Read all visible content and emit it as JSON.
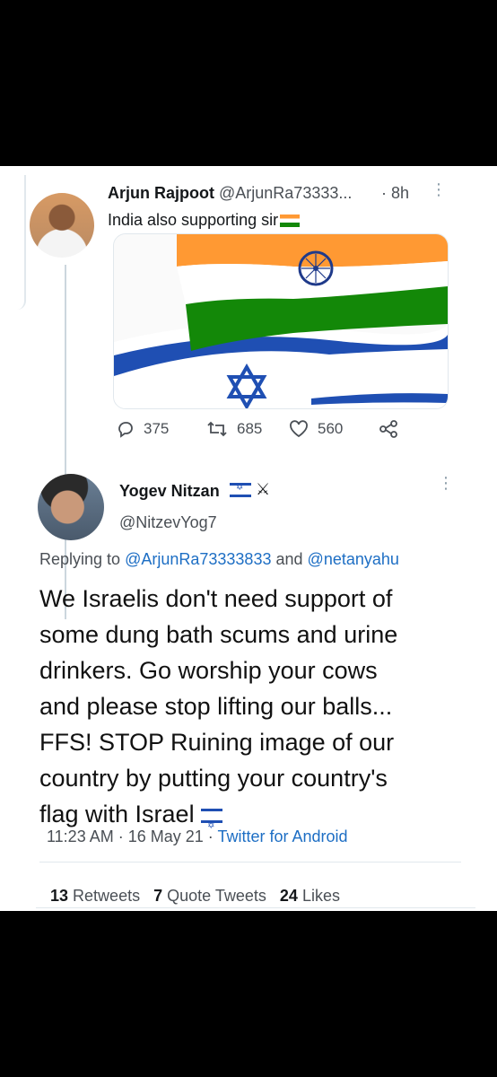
{
  "reply_tweet": {
    "author_name": "Arjun Rajpoot",
    "author_handle": "@ArjunRa73333...",
    "time": "· 8h",
    "menu": "⋮",
    "text": "India also supporting sir",
    "actions": {
      "replies": "375",
      "retweets": "685",
      "likes": "560"
    }
  },
  "main_tweet": {
    "author_name": "Yogev Nitzan",
    "author_handle": "@NitzevYog7",
    "menu": "⋮",
    "replying_prefix": "Replying to",
    "replying_user1": "@ArjunRa73333833",
    "replying_and": "and",
    "replying_user2": "@netanyahu",
    "body_lines": [
      "We Israelis don't need support of",
      "some dung bath scums and urine",
      "drinkers. Go worship your cows",
      "and please stop lifting our balls...",
      "FFS! STOP Ruining image of our",
      "country by putting your country's",
      "flag with Israel"
    ],
    "time": "11:23 AM",
    "date": "16 May 21",
    "source": "Twitter for Android",
    "stats": {
      "retweets_count": "13",
      "retweets_label": "Retweets",
      "quotes_count": "7",
      "quotes_label": "Quote Tweets",
      "likes_count": "24",
      "likes_label": "Likes"
    }
  },
  "colors": {
    "accent": "#1d6ec4",
    "saffron": "#ff9933",
    "india_green": "#138808",
    "israel_blue": "#1f4fb3"
  }
}
